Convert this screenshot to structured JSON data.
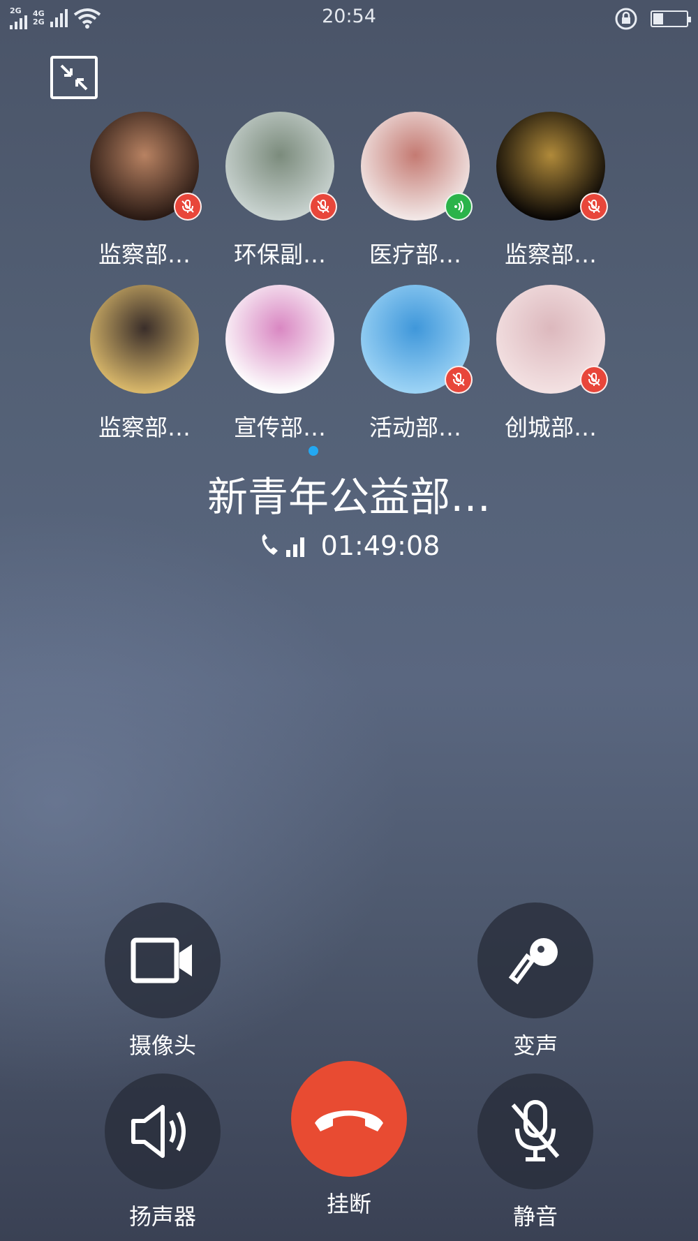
{
  "status_bar": {
    "net1": "2G",
    "net2_top": "4G",
    "net2_bottom": "2G",
    "time": "20:54",
    "battery_level": 0.3
  },
  "members": [
    {
      "name": "监察部…",
      "status": "muted",
      "avatar_colors": [
        "#2a1a14",
        "#b88262"
      ]
    },
    {
      "name": "环保副…",
      "status": "muted",
      "avatar_colors": [
        "#c9d3d0",
        "#7b8b7c"
      ]
    },
    {
      "name": "医疗部…",
      "status": "speaking",
      "avatar_colors": [
        "#f2e7e6",
        "#c47a72"
      ]
    },
    {
      "name": "监察部…",
      "status": "muted",
      "avatar_colors": [
        "#0a0705",
        "#b08a3a"
      ]
    },
    {
      "name": "监察部…",
      "status": "none",
      "avatar_colors": [
        "#d8b76a",
        "#3a2e2a"
      ]
    },
    {
      "name": "宣传部…",
      "status": "none",
      "avatar_colors": [
        "#fdfdfd",
        "#d987c2"
      ]
    },
    {
      "name": "活动部…",
      "status": "muted",
      "avatar_colors": [
        "#9cd3f5",
        "#3f97da"
      ]
    },
    {
      "name": "创城部…",
      "status": "muted",
      "avatar_colors": [
        "#f3e1e2",
        "#dcb8bd"
      ]
    }
  ],
  "call": {
    "group_name": "新青年公益部…",
    "duration": "01:49:08"
  },
  "controls": {
    "camera": "摄像头",
    "voice_changer": "变声",
    "speaker": "扬声器",
    "hangup": "挂断",
    "mute": "静音"
  },
  "colors": {
    "hangup": "#e84b32",
    "muted_badge": "#e8463a",
    "speaking_badge": "#2bb34a",
    "pager_dot": "#23a8f2"
  }
}
